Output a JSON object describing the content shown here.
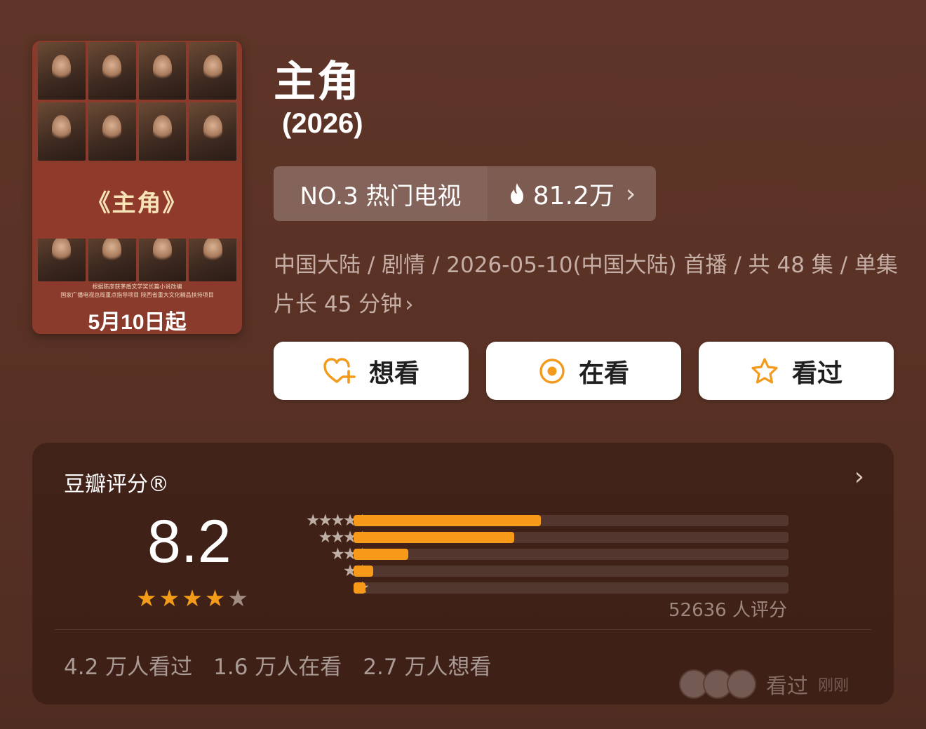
{
  "poster": {
    "title": "《主角》",
    "credits_line1": "根据陈彦获茅盾文学奖长篇小说改编",
    "credits_line2": "国家广播电视总局重点指导项目  陕西省重大文化精品扶持项目",
    "date": "5月10日起"
  },
  "show": {
    "title": "主角",
    "year": "(2026)"
  },
  "rank": {
    "label": "NO.3 热门电视",
    "heat": "81.2万",
    "chevron": "›"
  },
  "meta": {
    "info": "中国大陆 / 剧情 / 2026-05-10(中国大陆) 首播 / 共 48 集 / 单集片长 45 分钟",
    "chevron": "›"
  },
  "actions": {
    "want": "想看",
    "watching": "在看",
    "watched": "看过"
  },
  "rating": {
    "title": "豆瓣评分®",
    "chevron": "›",
    "score": "8.2",
    "score_stars": 4,
    "distribution": [
      {
        "stars": "★★★★★",
        "fraction": 0.43
      },
      {
        "stars": "★★★★",
        "fraction": 0.37
      },
      {
        "stars": "★★★",
        "fraction": 0.125
      },
      {
        "stars": "★★",
        "fraction": 0.045
      },
      {
        "stars": "★",
        "fraction": 0.028
      }
    ],
    "count": "52636 人评分",
    "stats": {
      "watched": "4.2 万人看过",
      "watching": "1.6 万人在看",
      "want": "2.7 万人想看"
    },
    "activity": {
      "label": "看过",
      "time": "刚刚"
    }
  },
  "colors": {
    "background": "#5a3225",
    "accent_orange": "#f79a1a",
    "button_bg": "#ffffff",
    "muted_text": "#c5aea5"
  }
}
